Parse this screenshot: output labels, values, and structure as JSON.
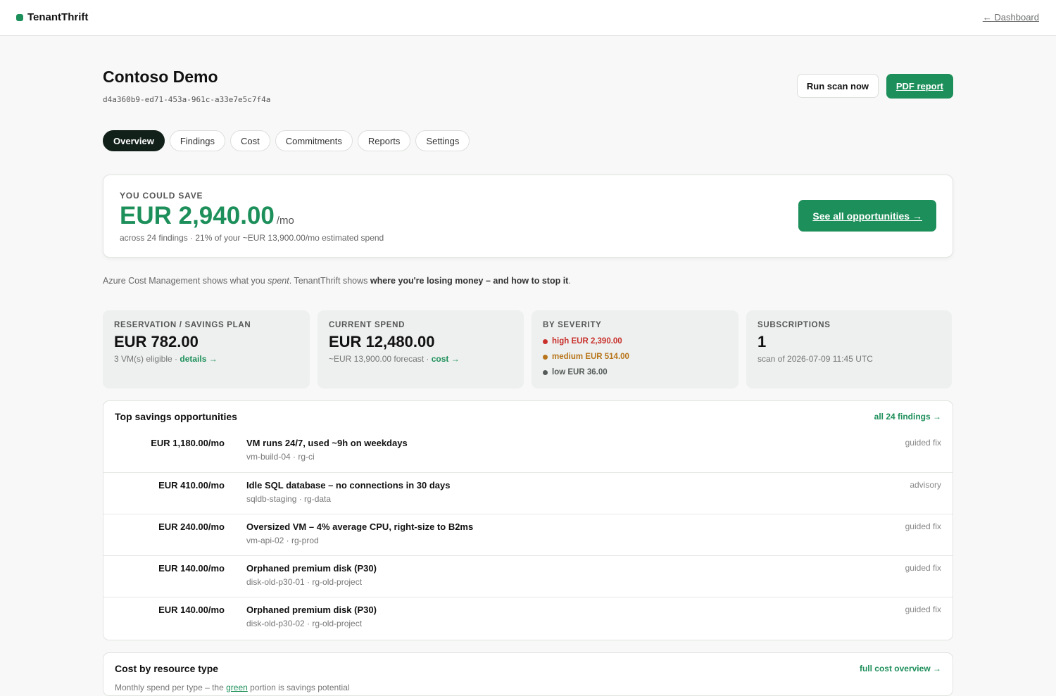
{
  "app": {
    "brand": "TenantThrift",
    "back_label": "← Dashboard"
  },
  "tenant": {
    "name": "Contoso Demo",
    "id": "d4a360b9-ed71-453a-961c-a33e7e5c7f4a"
  },
  "actions": {
    "run_scan": "Run scan now",
    "pdf_report": "PDF report"
  },
  "tabs": [
    {
      "label": "Overview",
      "active": true
    },
    {
      "label": "Findings",
      "active": false
    },
    {
      "label": "Cost",
      "active": false
    },
    {
      "label": "Commitments",
      "active": false
    },
    {
      "label": "Reports",
      "active": false
    },
    {
      "label": "Settings",
      "active": false
    }
  ],
  "savings": {
    "label": "YOU COULD SAVE",
    "amount": "EUR 2,940.00",
    "per": "/mo",
    "summary": "across 24 findings · 21% of your ~EUR 13,900.00/mo estimated spend",
    "cta": "See all opportunities →"
  },
  "tagline": {
    "part1": "Azure Cost Management shows what you ",
    "em": "spent",
    "part2": ". TenantThrift shows ",
    "bold": "where you're losing money – and how to stop it",
    "part3": "."
  },
  "stats": {
    "reservation": {
      "label": "RESERVATION / SAVINGS PLAN",
      "value": "EUR 782.00",
      "sub": "3 VM(s) eligible · ",
      "link": "details →"
    },
    "spend": {
      "label": "CURRENT SPEND",
      "value": "EUR 12,480.00",
      "sub": "~EUR 13,900.00 forecast · ",
      "link": "cost →"
    },
    "severity": {
      "label": "BY SEVERITY",
      "high": "high EUR 2,390.00",
      "medium": "medium EUR 514.00",
      "low": "low EUR 36.00"
    },
    "subscriptions": {
      "label": "SUBSCRIPTIONS",
      "value": "1",
      "sub": "scan of 2026-07-09 11:45 UTC"
    }
  },
  "top_savings": {
    "title": "Top savings opportunities",
    "link": "all 24 findings →",
    "rows": [
      {
        "amount": "EUR 1,180.00/mo",
        "title": "VM runs 24/7, used ~9h on weekdays",
        "resource": "vm-build-04 · rg-ci",
        "kind": "guided fix"
      },
      {
        "amount": "EUR 410.00/mo",
        "title": "Idle SQL database – no connections in 30 days",
        "resource": "sqldb-staging · rg-data",
        "kind": "advisory"
      },
      {
        "amount": "EUR 240.00/mo",
        "title": "Oversized VM – 4% average CPU, right-size to B2ms",
        "resource": "vm-api-02 · rg-prod",
        "kind": "guided fix"
      },
      {
        "amount": "EUR 140.00/mo",
        "title": "Orphaned premium disk (P30)",
        "resource": "disk-old-p30-01 · rg-old-project",
        "kind": "guided fix"
      },
      {
        "amount": "EUR 140.00/mo",
        "title": "Orphaned premium disk (P30)",
        "resource": "disk-old-p30-02 · rg-old-project",
        "kind": "guided fix"
      }
    ]
  },
  "cost_by_type": {
    "title": "Cost by resource type",
    "link": "full cost overview →",
    "sub_before": "Monthly spend per type – the ",
    "sub_green": "green",
    "sub_after": " portion is savings potential"
  },
  "colors": {
    "accent": "#1d8f5a",
    "high": "#c9302c",
    "medium": "#b8741a",
    "low": "#555b58"
  }
}
